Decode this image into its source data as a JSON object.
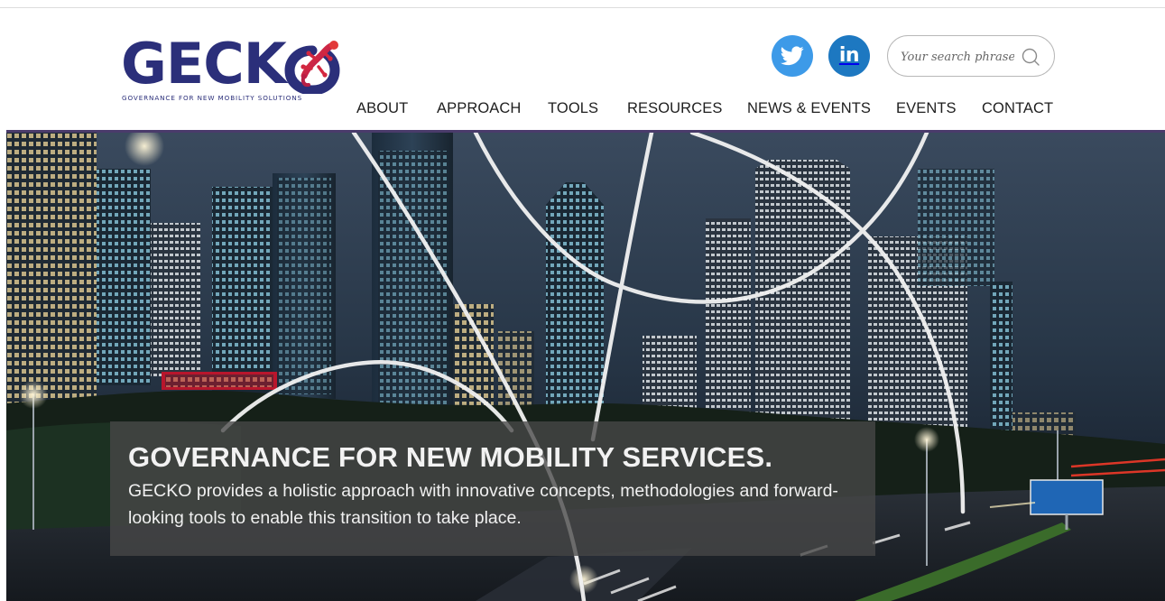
{
  "brand": {
    "logo_letters": "GECK",
    "tagline": "GOVERNANCE FOR NEW MOBILITY SOLUTIONS",
    "primary_color": "#2b2f7a",
    "accent_color": "#c8263b"
  },
  "social": {
    "twitter_icon": "twitter-bird-icon",
    "linkedin_label": "in"
  },
  "search": {
    "placeholder": "Your search phrase",
    "value": "",
    "icon": "search-icon"
  },
  "nav": {
    "items": [
      {
        "label": "ABOUT"
      },
      {
        "label": "APPROACH"
      },
      {
        "label": "TOOLS"
      },
      {
        "label": "RESOURCES"
      },
      {
        "label": "NEWS & EVENTS"
      },
      {
        "label": "EVENTS"
      },
      {
        "label": "CONTACT"
      }
    ]
  },
  "hero": {
    "title": "GOVERNANCE FOR NEW MOBILITY SERVICES.",
    "text": "GECKO provides a holistic approach with innovative concepts, methodologies and forward-looking tools to enable this transition to take place.",
    "image": "night-city-skyline-image"
  },
  "colors": {
    "nav_rule": "#4a3b6b",
    "twitter": "#3d9ae8",
    "linkedin": "#1d78c1"
  }
}
